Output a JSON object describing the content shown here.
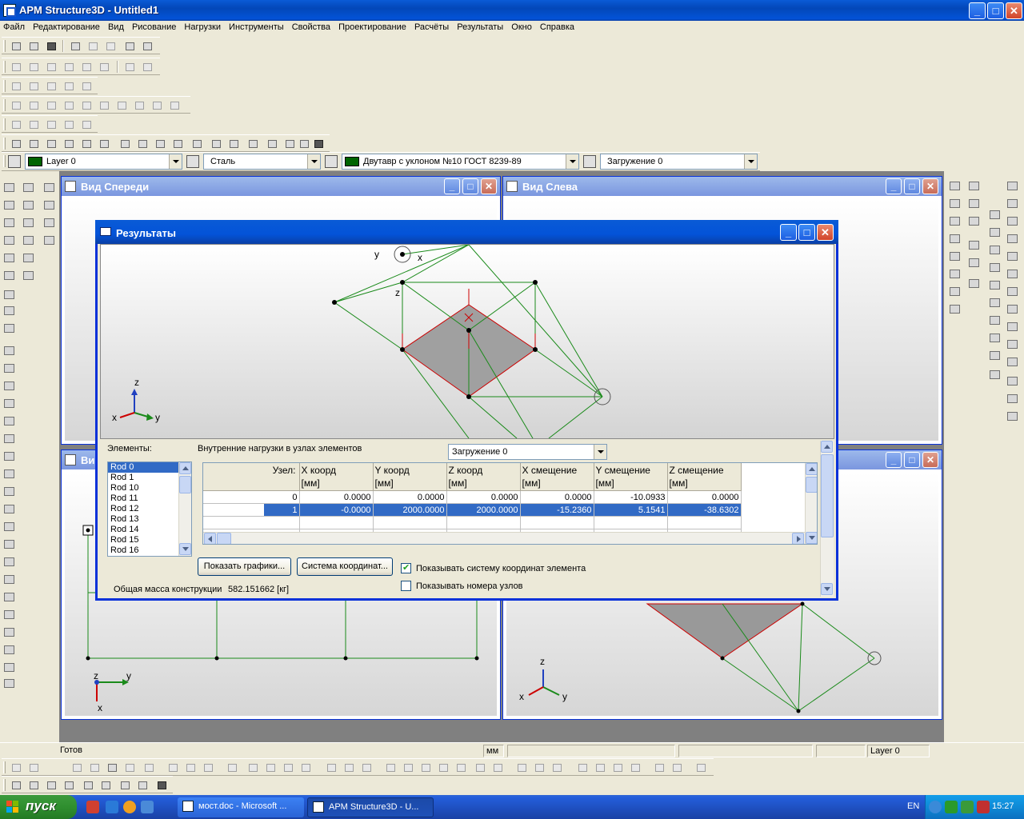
{
  "window": {
    "title": "APM Structure3D - Untitled1",
    "min": "_",
    "max": "□",
    "close": "✕"
  },
  "menu": [
    "Файл",
    "Редактирование",
    "Вид",
    "Рисование",
    "Нагрузки",
    "Инструменты",
    "Свойства",
    "Проектирование",
    "Расчёты",
    "Результаты",
    "Окно",
    "Справка"
  ],
  "combos": {
    "layer": "Layer 0",
    "material": "Сталь",
    "section": "Двутавр с уклоном  №10 ГОСТ 8239-89",
    "loading": "Загружение 0"
  },
  "colors": {
    "layer_swatch": "#006400",
    "section_swatch": "#006400",
    "title_blue": "#0a5bd6",
    "selection": "#316ac5",
    "model_green": "#1a8a1a"
  },
  "views": {
    "front": {
      "title": "Вид Спереди"
    },
    "left": {
      "title": "Вид Слева"
    },
    "bottom_left": {
      "title": "Ви"
    }
  },
  "dialog": {
    "title": "Результаты",
    "elements_label": "Элементы:",
    "internal_loads_label": "Внутренние нагрузки в узлах элементов",
    "loading_select": "Загружение 0",
    "elements": [
      "Rod 0",
      "Rod 1",
      "Rod 10",
      "Rod 11",
      "Rod 12",
      "Rod 13",
      "Rod 14",
      "Rod 15",
      "Rod 16"
    ],
    "selected_element": "Rod 0",
    "columns": [
      "Узел:",
      "X коорд\n[мм]",
      "Y коорд\n[мм]",
      "Z коорд\n[мм]",
      "X смещение\n[мм]",
      "Y смещение\n[мм]",
      "Z смещение\n[мм]"
    ],
    "rows": [
      [
        "0",
        "0.0000",
        "0.0000",
        "0.0000",
        "0.0000",
        "-10.0933",
        "0.0000"
      ],
      [
        "1",
        "-0.0000",
        "2000.0000",
        "2000.0000",
        "-15.2360",
        "5.1541",
        "-38.6302"
      ]
    ],
    "selected_row": 1,
    "show_graphs_button": "Показать графики...",
    "coord_system_button": "Система координат...",
    "show_coord_checkbox": "Показывать систему координат элемента",
    "show_coord_checked": true,
    "show_node_numbers_checkbox": "Показывать номера узлов",
    "show_node_numbers_checked": false,
    "total_mass_label": "Общая масса конструкции",
    "total_mass_value": "582.151662 [кг]"
  },
  "axes": {
    "x": "x",
    "y": "y",
    "z": "z"
  },
  "statusbar": {
    "status": "Готов",
    "units": "мм",
    "layer": "Layer 0"
  },
  "taskbar": {
    "start": "пуск",
    "tasks": [
      "мост.doc - Microsoft ...",
      "APM Structure3D - U..."
    ],
    "lang": "EN",
    "time": "15:27"
  }
}
